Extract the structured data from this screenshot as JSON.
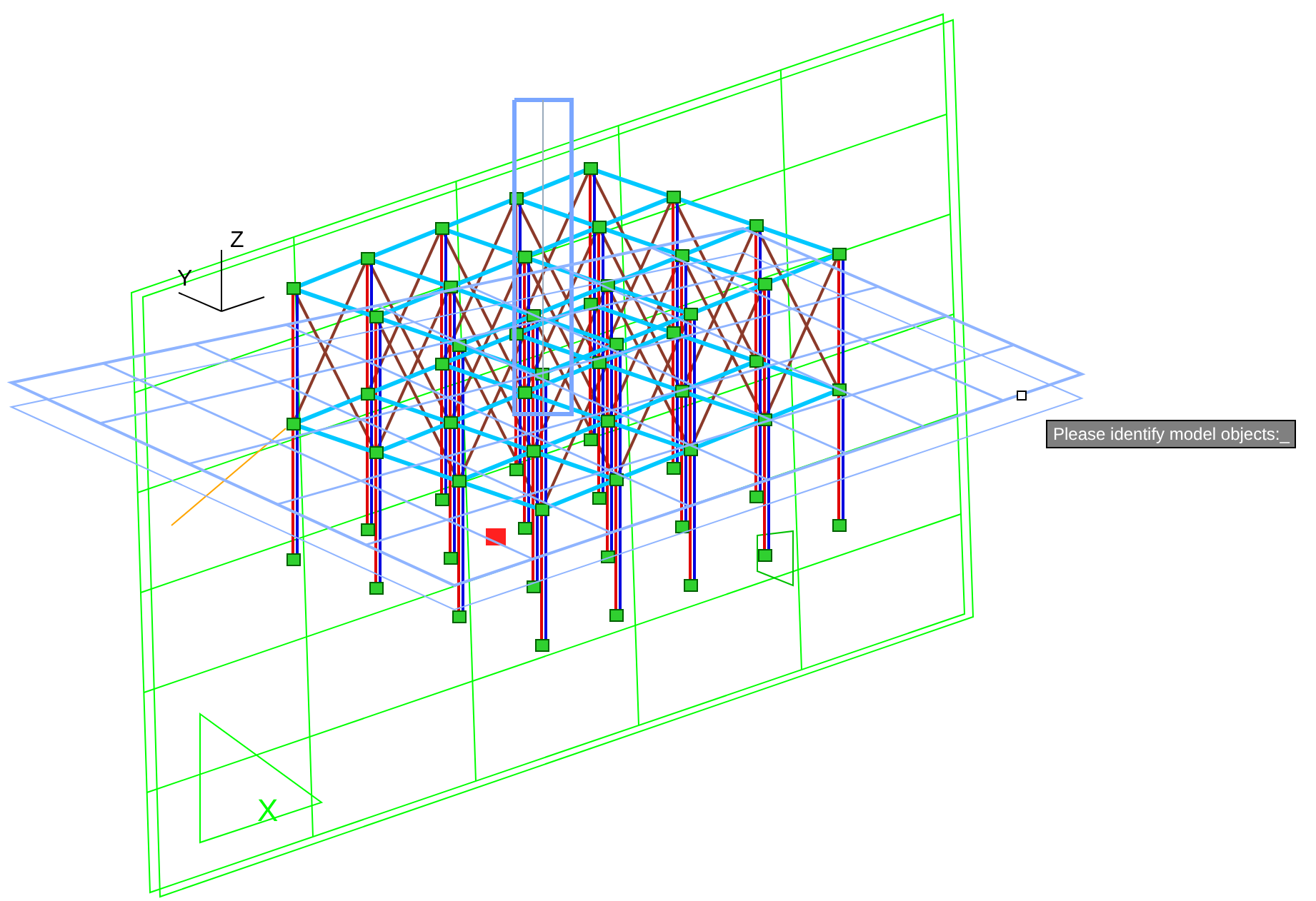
{
  "ucs_icon": {
    "z_label": "Z",
    "y_label": "Y"
  },
  "paper_space_icon": {
    "x_label": "X"
  },
  "command_prompt": {
    "text": "Please identify model objects:_"
  }
}
